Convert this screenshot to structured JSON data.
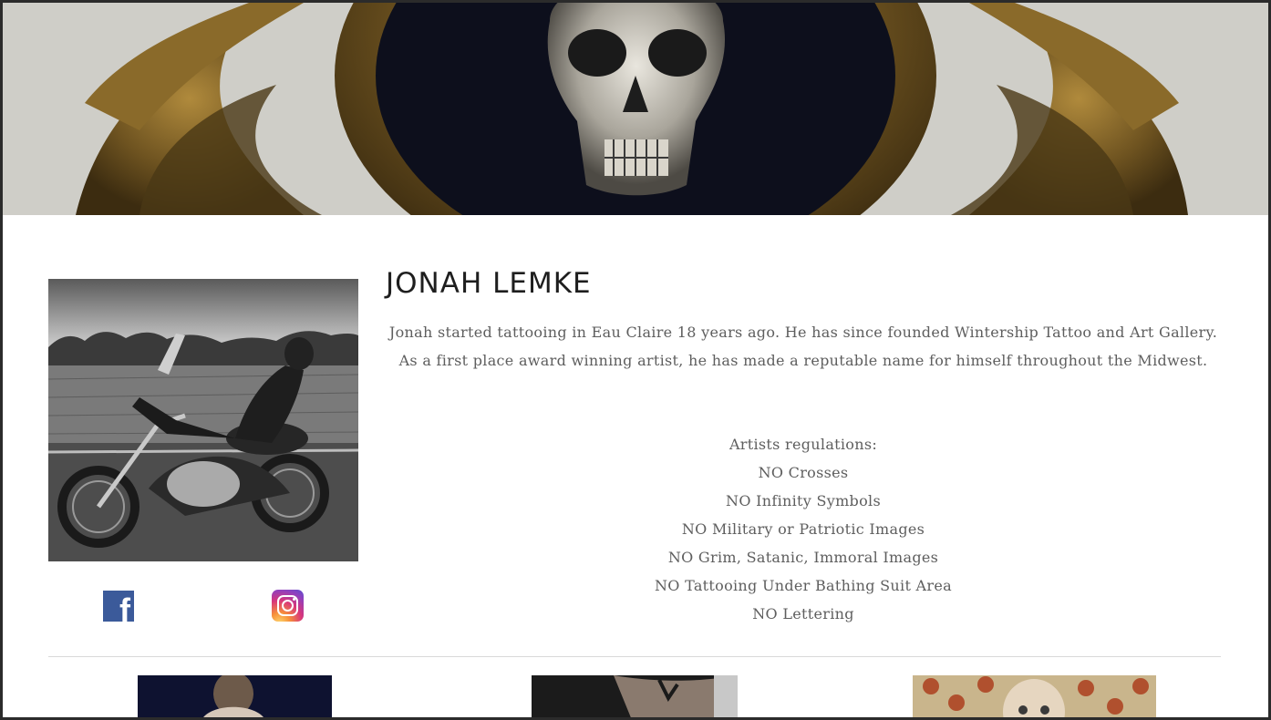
{
  "artist": {
    "name": "JONAH LEMKE",
    "bio_lines": [
      "Jonah started tattooing in Eau Claire 18 years ago. He has since founded Wintership Tattoo and Art Gallery.",
      "As a first place award winning artist, he has made a reputable name for himself throughout the Midwest."
    ]
  },
  "regulations": {
    "heading": "Artists regulations:",
    "items": [
      "NO Crosses",
      "NO Infinity Symbols",
      "NO Military or Patriotic Images",
      "NO Grim, Satanic, Immoral Images",
      "NO Tattooing Under Bathing Suit Area",
      "NO Lettering"
    ]
  },
  "social": {
    "facebook_glyph": "f",
    "facebook_icon": "facebook-icon",
    "instagram_icon": "instagram-icon",
    "facebook_color": "#3b5a9a"
  },
  "colors": {
    "heading_text": "#1e1e1e",
    "body_text": "#5e5e5e",
    "divider": "#d8d8d8"
  }
}
